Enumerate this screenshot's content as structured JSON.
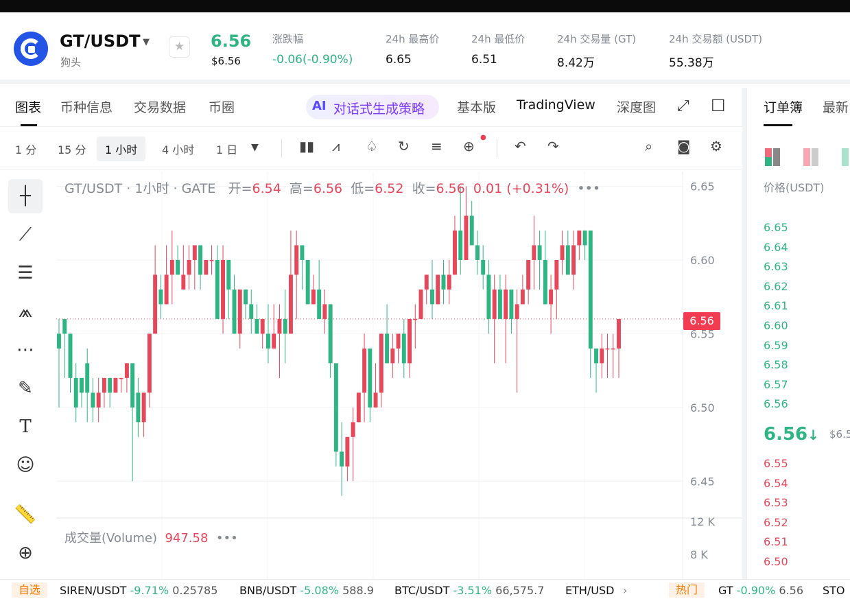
{
  "header": {
    "pair": "GT/USDT",
    "pair_name": "狗头",
    "price": "6.56",
    "price_usd": "$6.56",
    "stats": [
      {
        "label": "涨跌幅",
        "value": "-0.06(-0.90%)",
        "tone": "down"
      },
      {
        "label": "24h 最高价",
        "value": "6.65",
        "tone": "normal"
      },
      {
        "label": "24h 最低价",
        "value": "6.51",
        "tone": "normal"
      },
      {
        "label": "24h 交易量 (GT)",
        "value": "8.42万",
        "tone": "normal"
      },
      {
        "label": "24h 交易额 (USDT)",
        "value": "55.38万",
        "tone": "normal"
      }
    ]
  },
  "tabs": {
    "items": [
      "图表",
      "币种信息",
      "交易数据",
      "币圈"
    ],
    "ai_icon": "AI",
    "ai_label": "对话式生成策略",
    "views": [
      "基本版",
      "TradingView",
      "深度图"
    ]
  },
  "toolbar": {
    "timeframes": [
      "1 分",
      "15 分",
      "1 小时",
      "4 小时",
      "1 日"
    ],
    "active_timeframe": "1 小时"
  },
  "chart": {
    "legend_title": "GT/USDT · 1小时 · GATE",
    "open_label": "开=",
    "open": "6.54",
    "high_label": "高=",
    "high": "6.56",
    "low_label": "低=",
    "low": "6.52",
    "close_label": "收=",
    "close": "6.56",
    "change": "0.01 (+0.31%)",
    "price_tag": "6.56",
    "volume_label": "成交量(Volume)",
    "volume_value": "947.58"
  },
  "chart_data": {
    "type": "candlestick",
    "y_ticks": [
      "6.65",
      "6.60",
      "6.55",
      "6.50",
      "6.45"
    ],
    "ylim": [
      6.425,
      6.66
    ],
    "current_price": 6.56,
    "volume_ticks": [
      "12 K",
      "8 K"
    ],
    "volume_ylim": [
      0,
      12000
    ],
    "candles": [
      [
        6.55,
        6.56,
        6.5,
        6.54
      ],
      [
        6.56,
        6.56,
        6.52,
        6.55
      ],
      [
        6.55,
        6.55,
        6.51,
        6.52
      ],
      [
        6.52,
        6.53,
        6.49,
        6.5
      ],
      [
        6.52,
        6.52,
        6.5,
        6.51
      ],
      [
        6.53,
        6.54,
        6.49,
        6.51
      ],
      [
        6.51,
        6.52,
        6.49,
        6.5
      ],
      [
        6.5,
        6.52,
        6.49,
        6.51
      ],
      [
        6.51,
        6.52,
        6.5,
        6.52
      ],
      [
        6.52,
        6.52,
        6.5,
        6.51
      ],
      [
        6.51,
        6.52,
        6.51,
        6.52
      ],
      [
        6.52,
        6.52,
        6.51,
        6.52
      ],
      [
        6.52,
        6.53,
        6.51,
        6.53
      ],
      [
        6.53,
        6.53,
        6.45,
        6.5
      ],
      [
        6.51,
        6.52,
        6.48,
        6.49
      ],
      [
        6.49,
        6.51,
        6.48,
        6.51
      ],
      [
        6.51,
        6.55,
        6.5,
        6.55
      ],
      [
        6.55,
        6.61,
        6.55,
        6.59
      ],
      [
        6.58,
        6.59,
        6.56,
        6.57
      ],
      [
        6.57,
        6.61,
        6.57,
        6.59
      ],
      [
        6.59,
        6.62,
        6.57,
        6.6
      ],
      [
        6.6,
        6.61,
        6.59,
        6.59
      ],
      [
        6.58,
        6.61,
        6.58,
        6.59
      ],
      [
        6.59,
        6.61,
        6.58,
        6.6
      ],
      [
        6.6,
        6.61,
        6.58,
        6.61
      ],
      [
        6.61,
        6.61,
        6.58,
        6.59
      ],
      [
        6.59,
        6.6,
        6.59,
        6.6
      ],
      [
        6.6,
        6.61,
        6.59,
        6.6
      ],
      [
        6.6,
        6.61,
        6.56,
        6.56
      ],
      [
        6.56,
        6.61,
        6.55,
        6.6
      ],
      [
        6.6,
        6.6,
        6.56,
        6.58
      ],
      [
        6.58,
        6.59,
        6.55,
        6.55
      ],
      [
        6.55,
        6.58,
        6.54,
        6.58
      ],
      [
        6.58,
        6.58,
        6.56,
        6.57
      ],
      [
        6.57,
        6.58,
        6.55,
        6.56
      ],
      [
        6.56,
        6.57,
        6.55,
        6.55
      ],
      [
        6.55,
        6.56,
        6.54,
        6.56
      ],
      [
        6.55,
        6.57,
        6.53,
        6.54
      ],
      [
        6.54,
        6.57,
        6.54,
        6.55
      ],
      [
        6.55,
        6.57,
        6.52,
        6.56
      ],
      [
        6.56,
        6.58,
        6.53,
        6.55
      ],
      [
        6.55,
        6.62,
        6.55,
        6.59
      ],
      [
        6.59,
        6.62,
        6.56,
        6.61
      ],
      [
        6.61,
        6.61,
        6.58,
        6.6
      ],
      [
        6.6,
        6.6,
        6.57,
        6.57
      ],
      [
        6.57,
        6.59,
        6.57,
        6.58
      ],
      [
        6.58,
        6.6,
        6.56,
        6.56
      ],
      [
        6.56,
        6.58,
        6.55,
        6.57
      ],
      [
        6.57,
        6.57,
        6.52,
        6.53
      ],
      [
        6.53,
        6.53,
        6.46,
        6.47
      ],
      [
        6.47,
        6.49,
        6.44,
        6.46
      ],
      [
        6.46,
        6.48,
        6.45,
        6.48
      ],
      [
        6.48,
        6.5,
        6.45,
        6.49
      ],
      [
        6.49,
        6.51,
        6.49,
        6.51
      ],
      [
        6.51,
        6.55,
        6.49,
        6.54
      ],
      [
        6.54,
        6.54,
        6.49,
        6.5
      ],
      [
        6.5,
        6.53,
        6.5,
        6.51
      ],
      [
        6.51,
        6.55,
        6.5,
        6.55
      ],
      [
        6.55,
        6.57,
        6.53,
        6.53
      ],
      [
        6.53,
        6.55,
        6.52,
        6.54
      ],
      [
        6.54,
        6.55,
        6.53,
        6.55
      ],
      [
        6.55,
        6.56,
        6.52,
        6.53
      ],
      [
        6.53,
        6.56,
        6.52,
        6.56
      ],
      [
        6.56,
        6.57,
        6.54,
        6.56
      ],
      [
        6.56,
        6.58,
        6.56,
        6.58
      ],
      [
        6.58,
        6.59,
        6.57,
        6.59
      ],
      [
        6.58,
        6.6,
        6.56,
        6.57
      ],
      [
        6.57,
        6.59,
        6.57,
        6.59
      ],
      [
        6.59,
        6.6,
        6.57,
        6.58
      ],
      [
        6.58,
        6.6,
        6.57,
        6.59
      ],
      [
        6.59,
        6.63,
        6.59,
        6.62
      ],
      [
        6.62,
        6.65,
        6.59,
        6.6
      ],
      [
        6.6,
        6.65,
        6.6,
        6.63
      ],
      [
        6.63,
        6.64,
        6.61,
        6.61
      ],
      [
        6.61,
        6.62,
        6.59,
        6.6
      ],
      [
        6.6,
        6.61,
        6.58,
        6.59
      ],
      [
        6.59,
        6.6,
        6.55,
        6.56
      ],
      [
        6.56,
        6.59,
        6.53,
        6.58
      ],
      [
        6.58,
        6.59,
        6.56,
        6.56
      ],
      [
        6.56,
        6.59,
        6.53,
        6.58
      ],
      [
        6.58,
        6.58,
        6.55,
        6.56
      ],
      [
        6.56,
        6.58,
        6.51,
        6.57
      ],
      [
        6.57,
        6.59,
        6.57,
        6.58
      ],
      [
        6.58,
        6.6,
        6.57,
        6.6
      ],
      [
        6.6,
        6.63,
        6.58,
        6.61
      ],
      [
        6.61,
        6.62,
        6.58,
        6.6
      ],
      [
        6.6,
        6.62,
        6.57,
        6.57
      ],
      [
        6.57,
        6.59,
        6.55,
        6.58
      ],
      [
        6.58,
        6.6,
        6.56,
        6.6
      ],
      [
        6.6,
        6.62,
        6.59,
        6.61
      ],
      [
        6.61,
        6.62,
        6.59,
        6.59
      ],
      [
        6.59,
        6.62,
        6.58,
        6.61
      ],
      [
        6.61,
        6.62,
        6.6,
        6.62
      ],
      [
        6.62,
        6.62,
        6.6,
        6.61
      ],
      [
        6.62,
        6.62,
        6.52,
        6.54
      ],
      [
        6.54,
        6.54,
        6.51,
        6.53
      ],
      [
        6.53,
        6.55,
        6.52,
        6.54
      ],
      [
        6.54,
        6.55,
        6.52,
        6.54
      ],
      [
        6.54,
        6.55,
        6.52,
        6.54
      ],
      [
        6.54,
        6.56,
        6.52,
        6.56
      ]
    ]
  },
  "orderbook": {
    "title": "订单簿",
    "title2": "最新",
    "price_header": "价格(USDT)",
    "asks": [
      "6.65",
      "6.64",
      "6.63",
      "6.62",
      "6.61",
      "6.60",
      "6.59",
      "6.58",
      "6.57",
      "6.56"
    ],
    "mid_price": "6.56",
    "mid_arrow": "↓",
    "mid_sub": "$6.5",
    "bids": [
      "6.55",
      "6.54",
      "6.53",
      "6.52",
      "6.51",
      "6.50"
    ]
  },
  "ticker": {
    "tag_watch": "自选",
    "tag_hot": "热门",
    "items": [
      {
        "pair": "SIREN/USDT",
        "chg": "-9.71%",
        "px": "0.25785",
        "dir": "up"
      },
      {
        "pair": "BNB/USDT",
        "chg": "-5.08%",
        "px": "588.9",
        "dir": "dn"
      },
      {
        "pair": "BTC/USDT",
        "chg": "-3.51%",
        "px": "66,575.7",
        "dir": "dn"
      },
      {
        "pair": "ETH/USD",
        "chg": "",
        "px": "",
        "dir": "dn"
      }
    ],
    "hot_items": [
      {
        "pair": "GT",
        "chg": "-0.90%",
        "px": "6.56",
        "dir": "up"
      },
      {
        "pair": "STO",
        "chg": "",
        "px": "",
        "dir": "dn"
      }
    ]
  },
  "colors": {
    "up": "#2fb583",
    "down": "#e5475b",
    "accent": "#2354e6"
  }
}
